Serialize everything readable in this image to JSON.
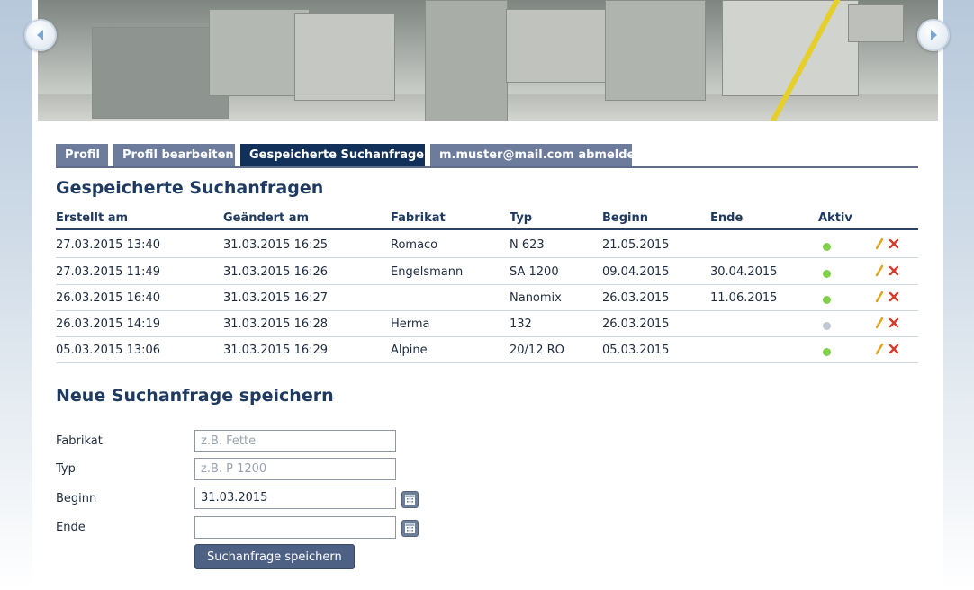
{
  "tabs": [
    {
      "label": "Profil",
      "active": false
    },
    {
      "label": "Profil bearbeiten",
      "active": false
    },
    {
      "label": "Gespeicherte Suchanfragen",
      "active": true
    },
    {
      "label": "m.muster@mail.com abmelden",
      "active": false
    }
  ],
  "saved_searches": {
    "title": "Gespeicherte Suchanfragen",
    "columns": [
      "Erstellt am",
      "Geändert am",
      "Fabrikat",
      "Typ",
      "Beginn",
      "Ende",
      "Aktiv"
    ],
    "rows": [
      {
        "created": "27.03.2015 13:40",
        "changed": "31.03.2015 16:25",
        "make": "Romaco",
        "type": "N 623",
        "start": "21.05.2015",
        "end": "",
        "active": true
      },
      {
        "created": "27.03.2015 11:49",
        "changed": "31.03.2015 16:26",
        "make": "Engelsmann",
        "type": "SA 1200",
        "start": "09.04.2015",
        "end": "30.04.2015",
        "active": true
      },
      {
        "created": "26.03.2015 16:40",
        "changed": "31.03.2015 16:27",
        "make": "",
        "type": "Nanomix",
        "start": "26.03.2015",
        "end": "11.06.2015",
        "active": true
      },
      {
        "created": "26.03.2015 14:19",
        "changed": "31.03.2015 16:28",
        "make": "Herma",
        "type": "132",
        "start": "26.03.2015",
        "end": "",
        "active": false
      },
      {
        "created": "05.03.2015 13:06",
        "changed": "31.03.2015 16:29",
        "make": "Alpine",
        "type": "20/12 RO",
        "start": "05.03.2015",
        "end": "",
        "active": true
      }
    ],
    "status_colors": {
      "active": "#82d14a",
      "inactive": "#c0c8d2"
    },
    "row_icons": [
      "pencil-icon",
      "delete-x-icon"
    ]
  },
  "new_search": {
    "title": "Neue Suchanfrage speichern",
    "fields": [
      {
        "label": "Fabrikat",
        "value": "",
        "placeholder": "z.B. Fette",
        "calendar": false
      },
      {
        "label": "Typ",
        "value": "",
        "placeholder": "z.B. P 1200",
        "calendar": false
      },
      {
        "label": "Beginn",
        "value": "31.03.2015",
        "placeholder": "",
        "calendar": true
      },
      {
        "label": "Ende",
        "value": "",
        "placeholder": "",
        "calendar": true
      }
    ],
    "submit_label": "Suchanfrage speichern"
  },
  "colors": {
    "tab_bg": "#6d7c9c",
    "tab_active_bg": "#12315a",
    "heading": "#1e3a60",
    "button_bg": "#4d6184"
  },
  "icons": [
    "chevron-left-icon",
    "chevron-right-icon",
    "calendar-icon"
  ]
}
